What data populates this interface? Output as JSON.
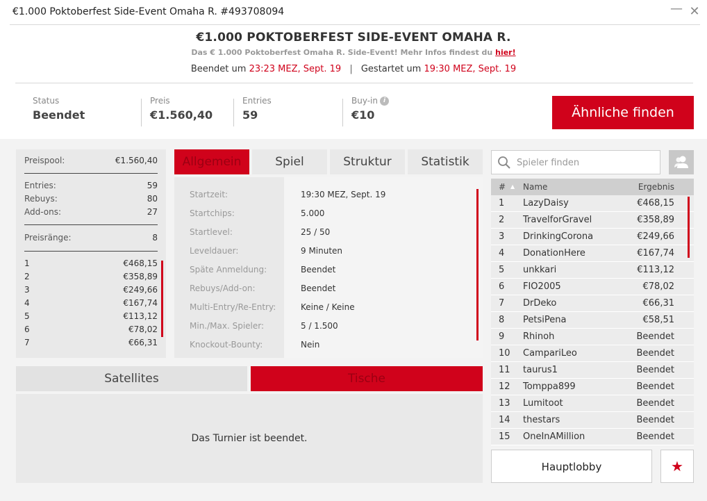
{
  "window": {
    "title": "€1.000 Poktoberfest Side-Event Omaha R. #493708094",
    "minimize": "—",
    "close": "✕"
  },
  "header": {
    "title": "€1.000 POKTOBERFEST SIDE-EVENT OMAHA R.",
    "subtitle": "Das € 1.000 Poktoberfest Omaha R. Side-Event! Mehr Infos findest du",
    "link": "hier!",
    "ended_label": "Beendet um",
    "ended_time": "23:23 MEZ, Sept. 19",
    "separator": "|",
    "started_label": "Gestartet um",
    "started_time": "19:30 MEZ, Sept. 19"
  },
  "stats": {
    "status_label": "Status",
    "status_value": "Beendet",
    "prize_label": "Preis",
    "prize_value": "€1.560,40",
    "entries_label": "Entries",
    "entries_value": "59",
    "buyin_label": "Buy-in",
    "buyin_value": "€10",
    "info_glyph": "i"
  },
  "similar_button": "Ähnliche finden",
  "prize_panel": {
    "pool_label": "Preispool:",
    "pool_value": "€1.560,40",
    "entries_label": "Entries:",
    "entries_value": "59",
    "rebuys_label": "Rebuys:",
    "rebuys_value": "80",
    "addons_label": "Add-ons:",
    "addons_value": "27",
    "ranges_label": "Preisränge:",
    "ranges_value": "8",
    "prizes": [
      {
        "rank": "1",
        "amount": "€468,15"
      },
      {
        "rank": "2",
        "amount": "€358,89"
      },
      {
        "rank": "3",
        "amount": "€249,66"
      },
      {
        "rank": "4",
        "amount": "€167,74"
      },
      {
        "rank": "5",
        "amount": "€113,12"
      },
      {
        "rank": "6",
        "amount": "€78,02"
      },
      {
        "rank": "7",
        "amount": "€66,31"
      }
    ]
  },
  "tabs": [
    "Allgemein",
    "Spiel",
    "Struktur",
    "Statistik"
  ],
  "details": [
    {
      "label": "Startzeit:",
      "value": "19:30 MEZ, Sept. 19"
    },
    {
      "label": "Startchips:",
      "value": "5.000"
    },
    {
      "label": "Startlevel:",
      "value": "25 / 50"
    },
    {
      "label": "Leveldauer:",
      "value": "9 Minuten"
    },
    {
      "label": "Späte Anmeldung:",
      "value": "Beendet"
    },
    {
      "label": "Rebuys/Add-on:",
      "value": "Beendet"
    },
    {
      "label": "Multi-Entry/Re-Entry:",
      "value": "Keine / Keine"
    },
    {
      "label": "Min./Max. Spieler:",
      "value": "5 / 1.500"
    },
    {
      "label": "Knockout-Bounty:",
      "value": "Nein"
    }
  ],
  "bottom_tabs": {
    "satellites": "Satellites",
    "tables": "Tische"
  },
  "ended_message": "Das Turnier ist beendet.",
  "search": {
    "placeholder": "Spieler finden"
  },
  "players": {
    "headers": {
      "num": "#",
      "name": "Name",
      "result": "Ergebnis"
    },
    "rows": [
      {
        "num": "1",
        "name": "LazyDaisy",
        "result": "€468,15"
      },
      {
        "num": "2",
        "name": "TravelforGravel",
        "result": "€358,89"
      },
      {
        "num": "3",
        "name": "DrinkingCorona",
        "result": "€249,66"
      },
      {
        "num": "4",
        "name": "DonationHere",
        "result": "€167,74"
      },
      {
        "num": "5",
        "name": "unkkari",
        "result": "€113,12"
      },
      {
        "num": "6",
        "name": "FIO2005",
        "result": "€78,02"
      },
      {
        "num": "7",
        "name": "DrDeko",
        "result": "€66,31"
      },
      {
        "num": "8",
        "name": "PetsiPena",
        "result": "€58,51"
      },
      {
        "num": "9",
        "name": "Rhinoh",
        "result": "Beendet"
      },
      {
        "num": "10",
        "name": "CampariLeo",
        "result": "Beendet"
      },
      {
        "num": "11",
        "name": "taurus1",
        "result": "Beendet"
      },
      {
        "num": "12",
        "name": "Tomppa899",
        "result": "Beendet"
      },
      {
        "num": "13",
        "name": "Lumitoot",
        "result": "Beendet"
      },
      {
        "num": "14",
        "name": "thestars",
        "result": "Beendet"
      },
      {
        "num": "15",
        "name": "OneInAMillion",
        "result": "Beendet"
      }
    ]
  },
  "hauptlobby": "Hauptlobby",
  "colors": {
    "accent": "#d0021b",
    "panel": "#e9e9e9"
  }
}
